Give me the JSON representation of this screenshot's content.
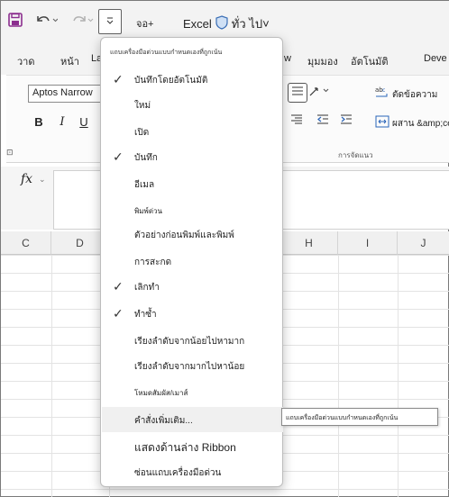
{
  "qat": {
    "extra_label": "จอ+",
    "title": "Excel",
    "title_suffix": "ทั่ว ไป˅"
  },
  "tabs": [
    "วาด",
    "หน้า",
    "La",
    "w",
    "มุมมอง",
    "อัตโนมัติ",
    "Deve"
  ],
  "ribbon": {
    "font_name": "Aptos Narrow",
    "bold": "B",
    "italic": "I",
    "underline": "U",
    "wrap_text": "ตัดข้อความ",
    "merge": "ผสาน &amp;ce",
    "group_label": "การจัดแนว",
    "launcher": "⊡"
  },
  "formula_bar": {
    "fx": "fx"
  },
  "columns": [
    "C",
    "D",
    "H",
    "I",
    "J"
  ],
  "menu": {
    "header": "แถบเครื่องมือด่วนแบบกำหนดเองที่ถูกเน้น",
    "items": [
      {
        "label": "บันทึกโดยอัตโนมัติ",
        "checked": true
      },
      {
        "label": "ใหม่",
        "checked": false
      },
      {
        "label": "เปิด",
        "checked": false
      },
      {
        "label": "บันทึก",
        "checked": true
      },
      {
        "label": "อีเมล",
        "checked": false
      },
      {
        "label": "พิมพ์ด่วน",
        "checked": false
      },
      {
        "label": "ตัวอย่างก่อนพิมพ์และพิมพ์",
        "checked": false
      },
      {
        "label": "การสะกด",
        "checked": false
      },
      {
        "label": "เลิกทำ",
        "checked": true
      },
      {
        "label": "ทำซ้ำ",
        "checked": true
      },
      {
        "label": "เรียงลำดับจากน้อยไปหามาก",
        "checked": false
      },
      {
        "label": "เรียงลำดับจากมากไปหาน้อย",
        "checked": false
      },
      {
        "label": "โหมดสัมผัส/เมาส์",
        "checked": false
      },
      {
        "label": "คำสั่งเพิ่มเติม...",
        "checked": false
      },
      {
        "label": "แสดงด้านล่าง Ribbon",
        "checked": false
      },
      {
        "label": "ซ่อนแถบเครื่องมือด่วน",
        "checked": false
      }
    ],
    "check_glyph": "✓"
  },
  "tooltip": "แถบเครื่องมือด่วนแบบกำหนดเองที่ถูกเน้น"
}
